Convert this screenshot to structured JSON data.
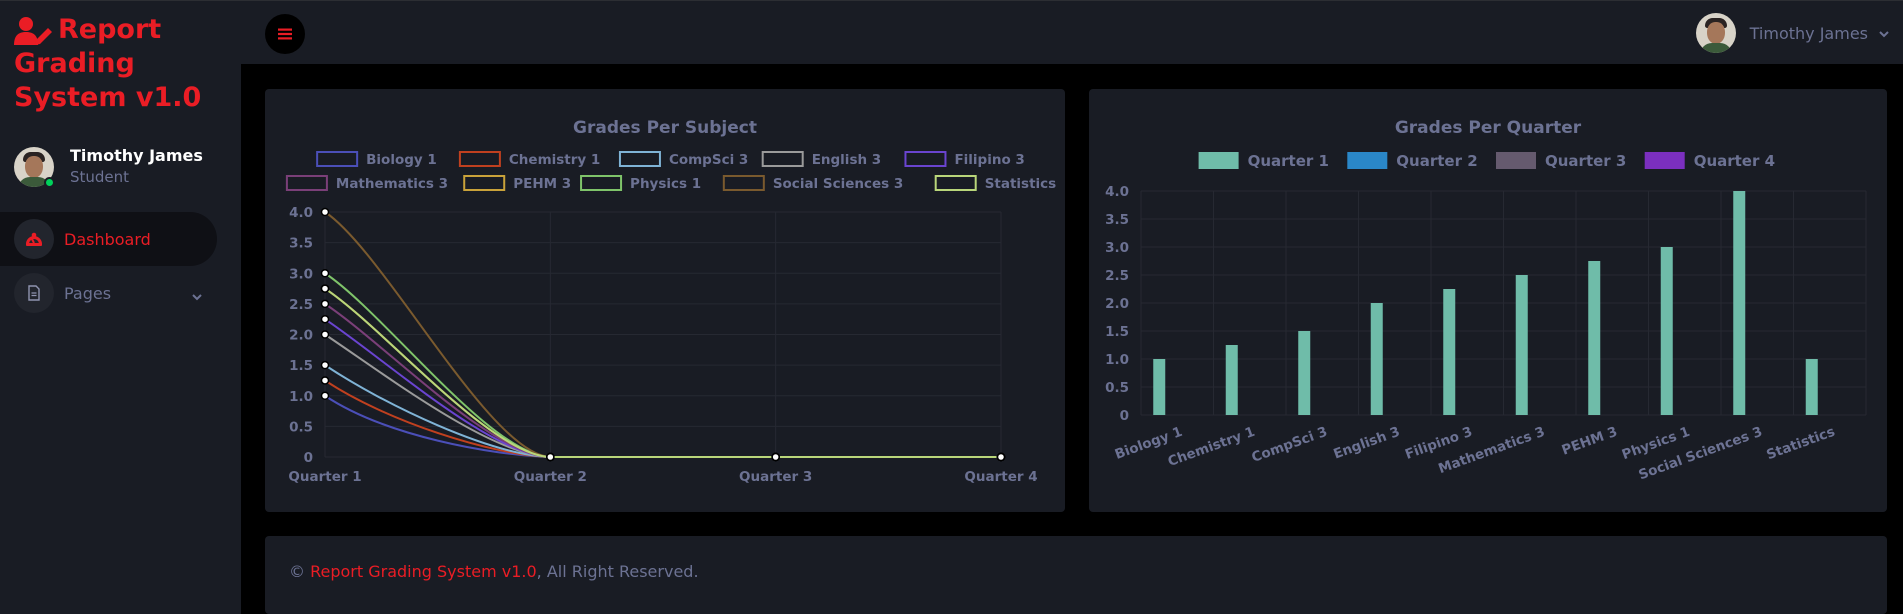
{
  "brand": {
    "title": "Report Grading System v1.0",
    "icon": "user-edit-icon",
    "color": "#ea1d25"
  },
  "profile": {
    "name": "Timothy James",
    "role": "Student",
    "status_color": "#00d25b"
  },
  "nav": {
    "items": [
      {
        "label": "Dashboard",
        "icon": "speedometer-icon",
        "active": true
      },
      {
        "label": "Pages",
        "icon": "document-icon",
        "active": false,
        "has_submenu": true
      }
    ]
  },
  "topbar": {
    "menu_icon": "hamburger-icon",
    "user_name": "Timothy James"
  },
  "chart_data": [
    {
      "type": "line",
      "title": "Grades Per Subject",
      "x": [
        "Quarter 1",
        "Quarter 2",
        "Quarter 3",
        "Quarter 4"
      ],
      "ylim": [
        0,
        4
      ],
      "yticks": [
        "0",
        "0.5",
        "1.0",
        "1.5",
        "2.0",
        "2.5",
        "3.0",
        "3.5",
        "4.0"
      ],
      "legend_position": "top",
      "grid": true,
      "series": [
        {
          "name": "Biology 1",
          "color": "#4b4fb8",
          "values": [
            1.0,
            0,
            0,
            0
          ]
        },
        {
          "name": "Chemistry 1",
          "color": "#c0401f",
          "values": [
            1.25,
            0,
            0,
            0
          ]
        },
        {
          "name": "CompSci 3",
          "color": "#7fb3d6",
          "values": [
            1.5,
            0,
            0,
            0
          ]
        },
        {
          "name": "English 3",
          "color": "#9a9a9a",
          "values": [
            2.0,
            0,
            0,
            0
          ]
        },
        {
          "name": "Filipino 3",
          "color": "#6a44d0",
          "values": [
            2.25,
            0,
            0,
            0
          ]
        },
        {
          "name": "Mathematics 3",
          "color": "#7a3f78",
          "values": [
            2.5,
            0,
            0,
            0
          ]
        },
        {
          "name": "PEHM 3",
          "color": "#c9a23a",
          "values": [
            2.75,
            0,
            0,
            0
          ]
        },
        {
          "name": "Physics 1",
          "color": "#7fc46a",
          "values": [
            3.0,
            0,
            0,
            0
          ]
        },
        {
          "name": "Social Sciences 3",
          "color": "#7a5a2e",
          "values": [
            4.0,
            0,
            0,
            0
          ]
        },
        {
          "name": "Statistics",
          "color": "#b9d67a",
          "values": [
            2.75,
            0,
            0,
            0
          ]
        }
      ]
    },
    {
      "type": "bar",
      "title": "Grades Per Quarter",
      "categories": [
        "Biology 1",
        "Chemistry 1",
        "CompSci 3",
        "English 3",
        "Filipino 3",
        "Mathematics 3",
        "PEHM 3",
        "Physics 1",
        "Social Sciences 3",
        "Statistics"
      ],
      "ylim": [
        0,
        4
      ],
      "yticks": [
        "0",
        "0.5",
        "1.0",
        "1.5",
        "2.0",
        "2.5",
        "3.0",
        "3.5",
        "4.0"
      ],
      "legend_position": "top",
      "grid": true,
      "series": [
        {
          "name": "Quarter 1",
          "color": "#6fbca9",
          "values": [
            1.0,
            1.25,
            1.5,
            2.0,
            2.25,
            2.5,
            2.75,
            3.0,
            4.0,
            1.0
          ]
        },
        {
          "name": "Quarter 2",
          "color": "#2a87c8",
          "values": [
            0,
            0,
            0,
            0,
            0,
            0,
            0,
            0,
            0,
            0
          ]
        },
        {
          "name": "Quarter 3",
          "color": "#655a6e",
          "values": [
            0,
            0,
            0,
            0,
            0,
            0,
            0,
            0,
            0,
            0
          ]
        },
        {
          "name": "Quarter 4",
          "color": "#7b2fbf",
          "values": [
            0,
            0,
            0,
            0,
            0,
            0,
            0,
            0,
            0,
            0
          ]
        }
      ]
    }
  ],
  "footer": {
    "copyright": "©",
    "link": "Report Grading System v1.0",
    "suffix": ", All Right Reserved."
  }
}
